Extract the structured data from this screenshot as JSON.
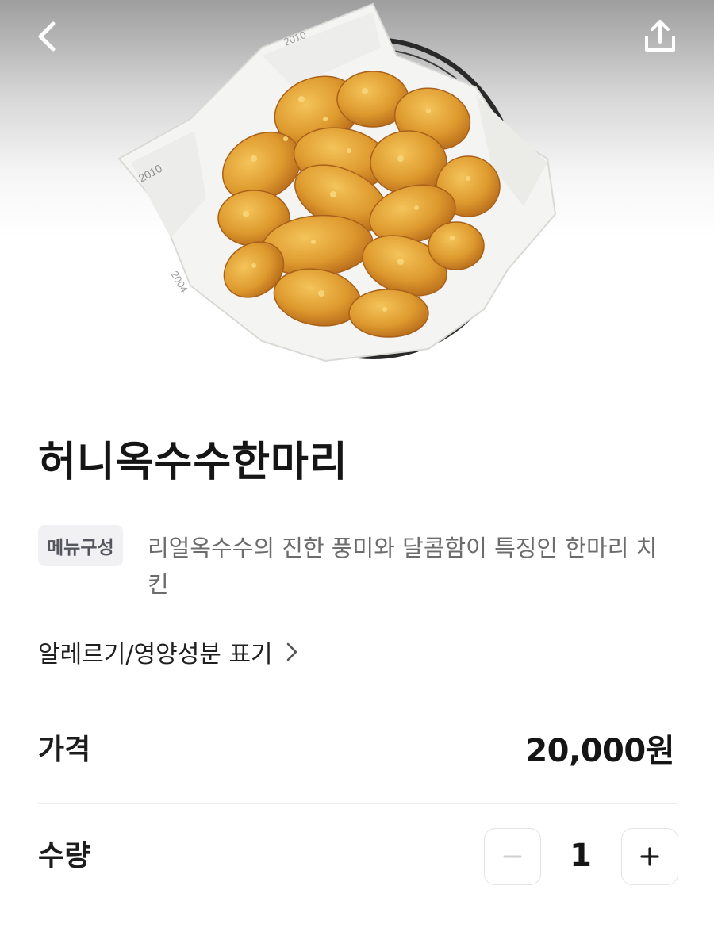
{
  "header": {
    "back_icon": "chevron-left-icon",
    "share_icon": "share-icon"
  },
  "product": {
    "name": "허니옥수수한마리",
    "menu_badge": "메뉴구성",
    "menu_description": "리얼옥수수의 진한 풍미와 달콤함이 특징인 한마리 치킨",
    "allergy_link_label": "알레르기/영양성분 표기",
    "price_label": "가격",
    "price_value": "20,000원",
    "quantity_label": "수량",
    "quantity_value": "1"
  },
  "colors": {
    "accent_text": "#151515",
    "muted_text": "#6c6c6c",
    "badge_bg": "#f1f1f4",
    "chicken": "#d99428"
  }
}
